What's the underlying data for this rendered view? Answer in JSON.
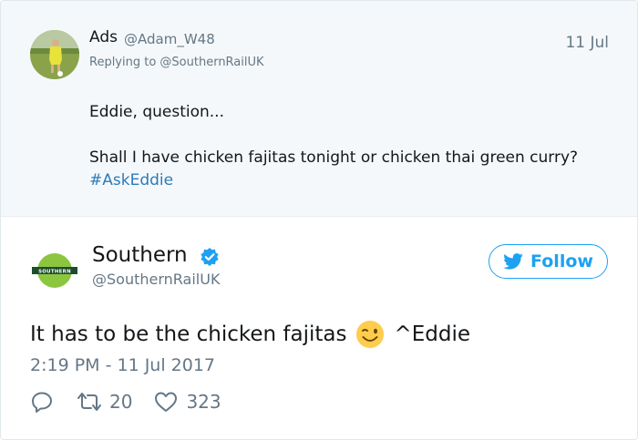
{
  "reply_tweet": {
    "author_name": "Ads",
    "author_handle": "@Adam_W48",
    "date": "11 Jul",
    "replying_to": "Replying to @SouthernRailUK",
    "line1": "Eddie, question...",
    "line2": "Shall I have chicken fajitas tonight or chicken thai green curry?",
    "hashtag": "#AskEddie"
  },
  "main_tweet": {
    "author_name": "Southern",
    "author_handle": "@SouthernRailUK",
    "logo_text": "SOUTHERN",
    "verified": true,
    "follow_label": "Follow",
    "text_before": "It has to be the chicken fajitas",
    "emoji": "winking-face",
    "text_after": "^Eddie",
    "timestamp": "2:19 PM - 11 Jul 2017",
    "retweets": "20",
    "likes": "323"
  },
  "colors": {
    "link": "#2b7bb9",
    "accent": "#1da1f2",
    "muted": "#657786",
    "reply_bg": "#f5f8fa"
  },
  "icons": [
    "reply-icon",
    "retweet-icon",
    "heart-icon",
    "twitter-bird-icon",
    "verified-icon",
    "winking-face-emoji"
  ]
}
